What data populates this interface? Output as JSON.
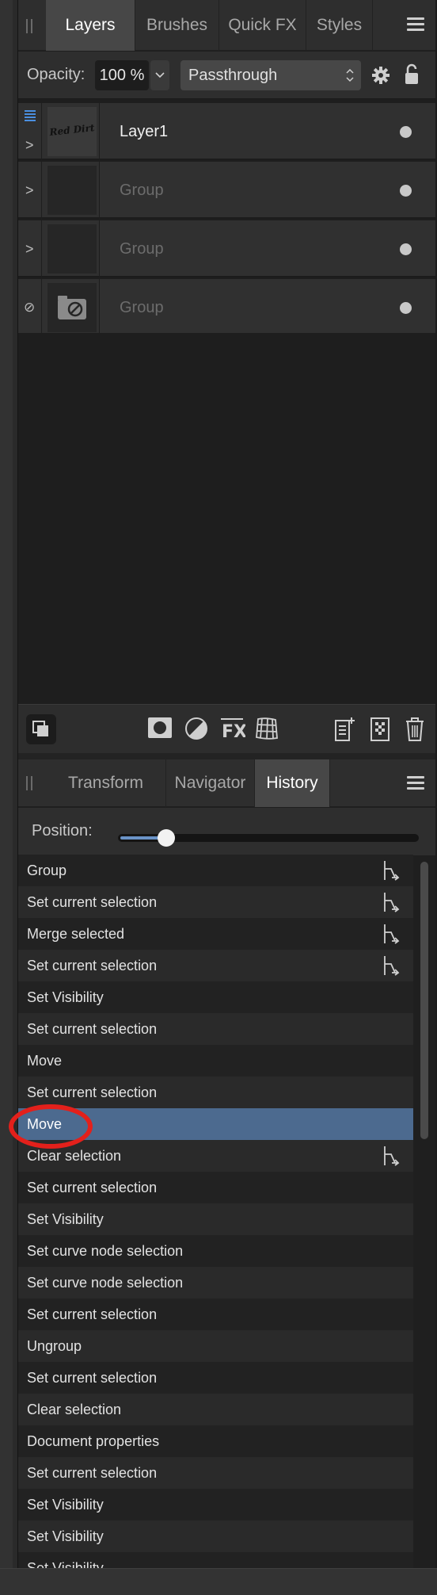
{
  "layers_panel": {
    "tabs": [
      {
        "label": "Layers",
        "active": true
      },
      {
        "label": "Brushes",
        "active": false
      },
      {
        "label": "Quick FX",
        "active": false
      },
      {
        "label": "Styles",
        "active": false
      }
    ],
    "opacity_label": "Opacity:",
    "opacity_value": "100 %",
    "blend_mode": "Passthrough",
    "layers": [
      {
        "name": "Layer1",
        "selected": true,
        "thumbnail_text": "Red Dirt",
        "expander": ">",
        "visible": true
      },
      {
        "name": "Group",
        "selected": false,
        "thumbnail_text": "",
        "expander": ">",
        "visible": true
      },
      {
        "name": "Group",
        "selected": false,
        "thumbnail_text": "",
        "expander": ">",
        "visible": true
      },
      {
        "name": "Group",
        "selected": false,
        "thumbnail_text": "",
        "expander": "⊘",
        "visible": true
      }
    ]
  },
  "history_panel": {
    "tabs": [
      {
        "label": "Transform",
        "active": false
      },
      {
        "label": "Navigator",
        "active": false
      },
      {
        "label": "History",
        "active": true
      }
    ],
    "position_label": "Position:",
    "position_fraction": 0.16,
    "items": [
      {
        "label": "Group",
        "branch": true
      },
      {
        "label": "Set current selection",
        "branch": true
      },
      {
        "label": "Merge selected",
        "branch": true
      },
      {
        "label": "Set current selection",
        "branch": true
      },
      {
        "label": "Set Visibility",
        "branch": false
      },
      {
        "label": "Set current selection",
        "branch": false
      },
      {
        "label": "Move",
        "branch": false
      },
      {
        "label": "Set current selection",
        "branch": false
      },
      {
        "label": "Move",
        "branch": false,
        "selected": true
      },
      {
        "label": "Clear selection",
        "branch": true
      },
      {
        "label": "Set current selection",
        "branch": false
      },
      {
        "label": "Set Visibility",
        "branch": false
      },
      {
        "label": "Set curve node selection",
        "branch": false
      },
      {
        "label": "Set curve node selection",
        "branch": false
      },
      {
        "label": "Set current selection",
        "branch": false
      },
      {
        "label": "Ungroup",
        "branch": false
      },
      {
        "label": "Set current selection",
        "branch": false
      },
      {
        "label": "Clear selection",
        "branch": false
      },
      {
        "label": "Document properties",
        "branch": false
      },
      {
        "label": "Set current selection",
        "branch": false
      },
      {
        "label": "Set Visibility",
        "branch": false
      },
      {
        "label": "Set Visibility",
        "branch": false
      },
      {
        "label": "Set Visibility",
        "branch": false
      }
    ]
  },
  "colors": {
    "selection_blue": "#4c6a8f",
    "annotation_red": "#e3201b"
  },
  "icons": {
    "toolbar_left": [
      "layer-stack-icon"
    ],
    "toolbar_center": [
      "mask-icon",
      "adjustment-icon",
      "fx-icon",
      "live-filter-icon"
    ],
    "toolbar_right": [
      "add-layer-icon",
      "add-pixel-layer-icon",
      "trash-icon"
    ]
  }
}
